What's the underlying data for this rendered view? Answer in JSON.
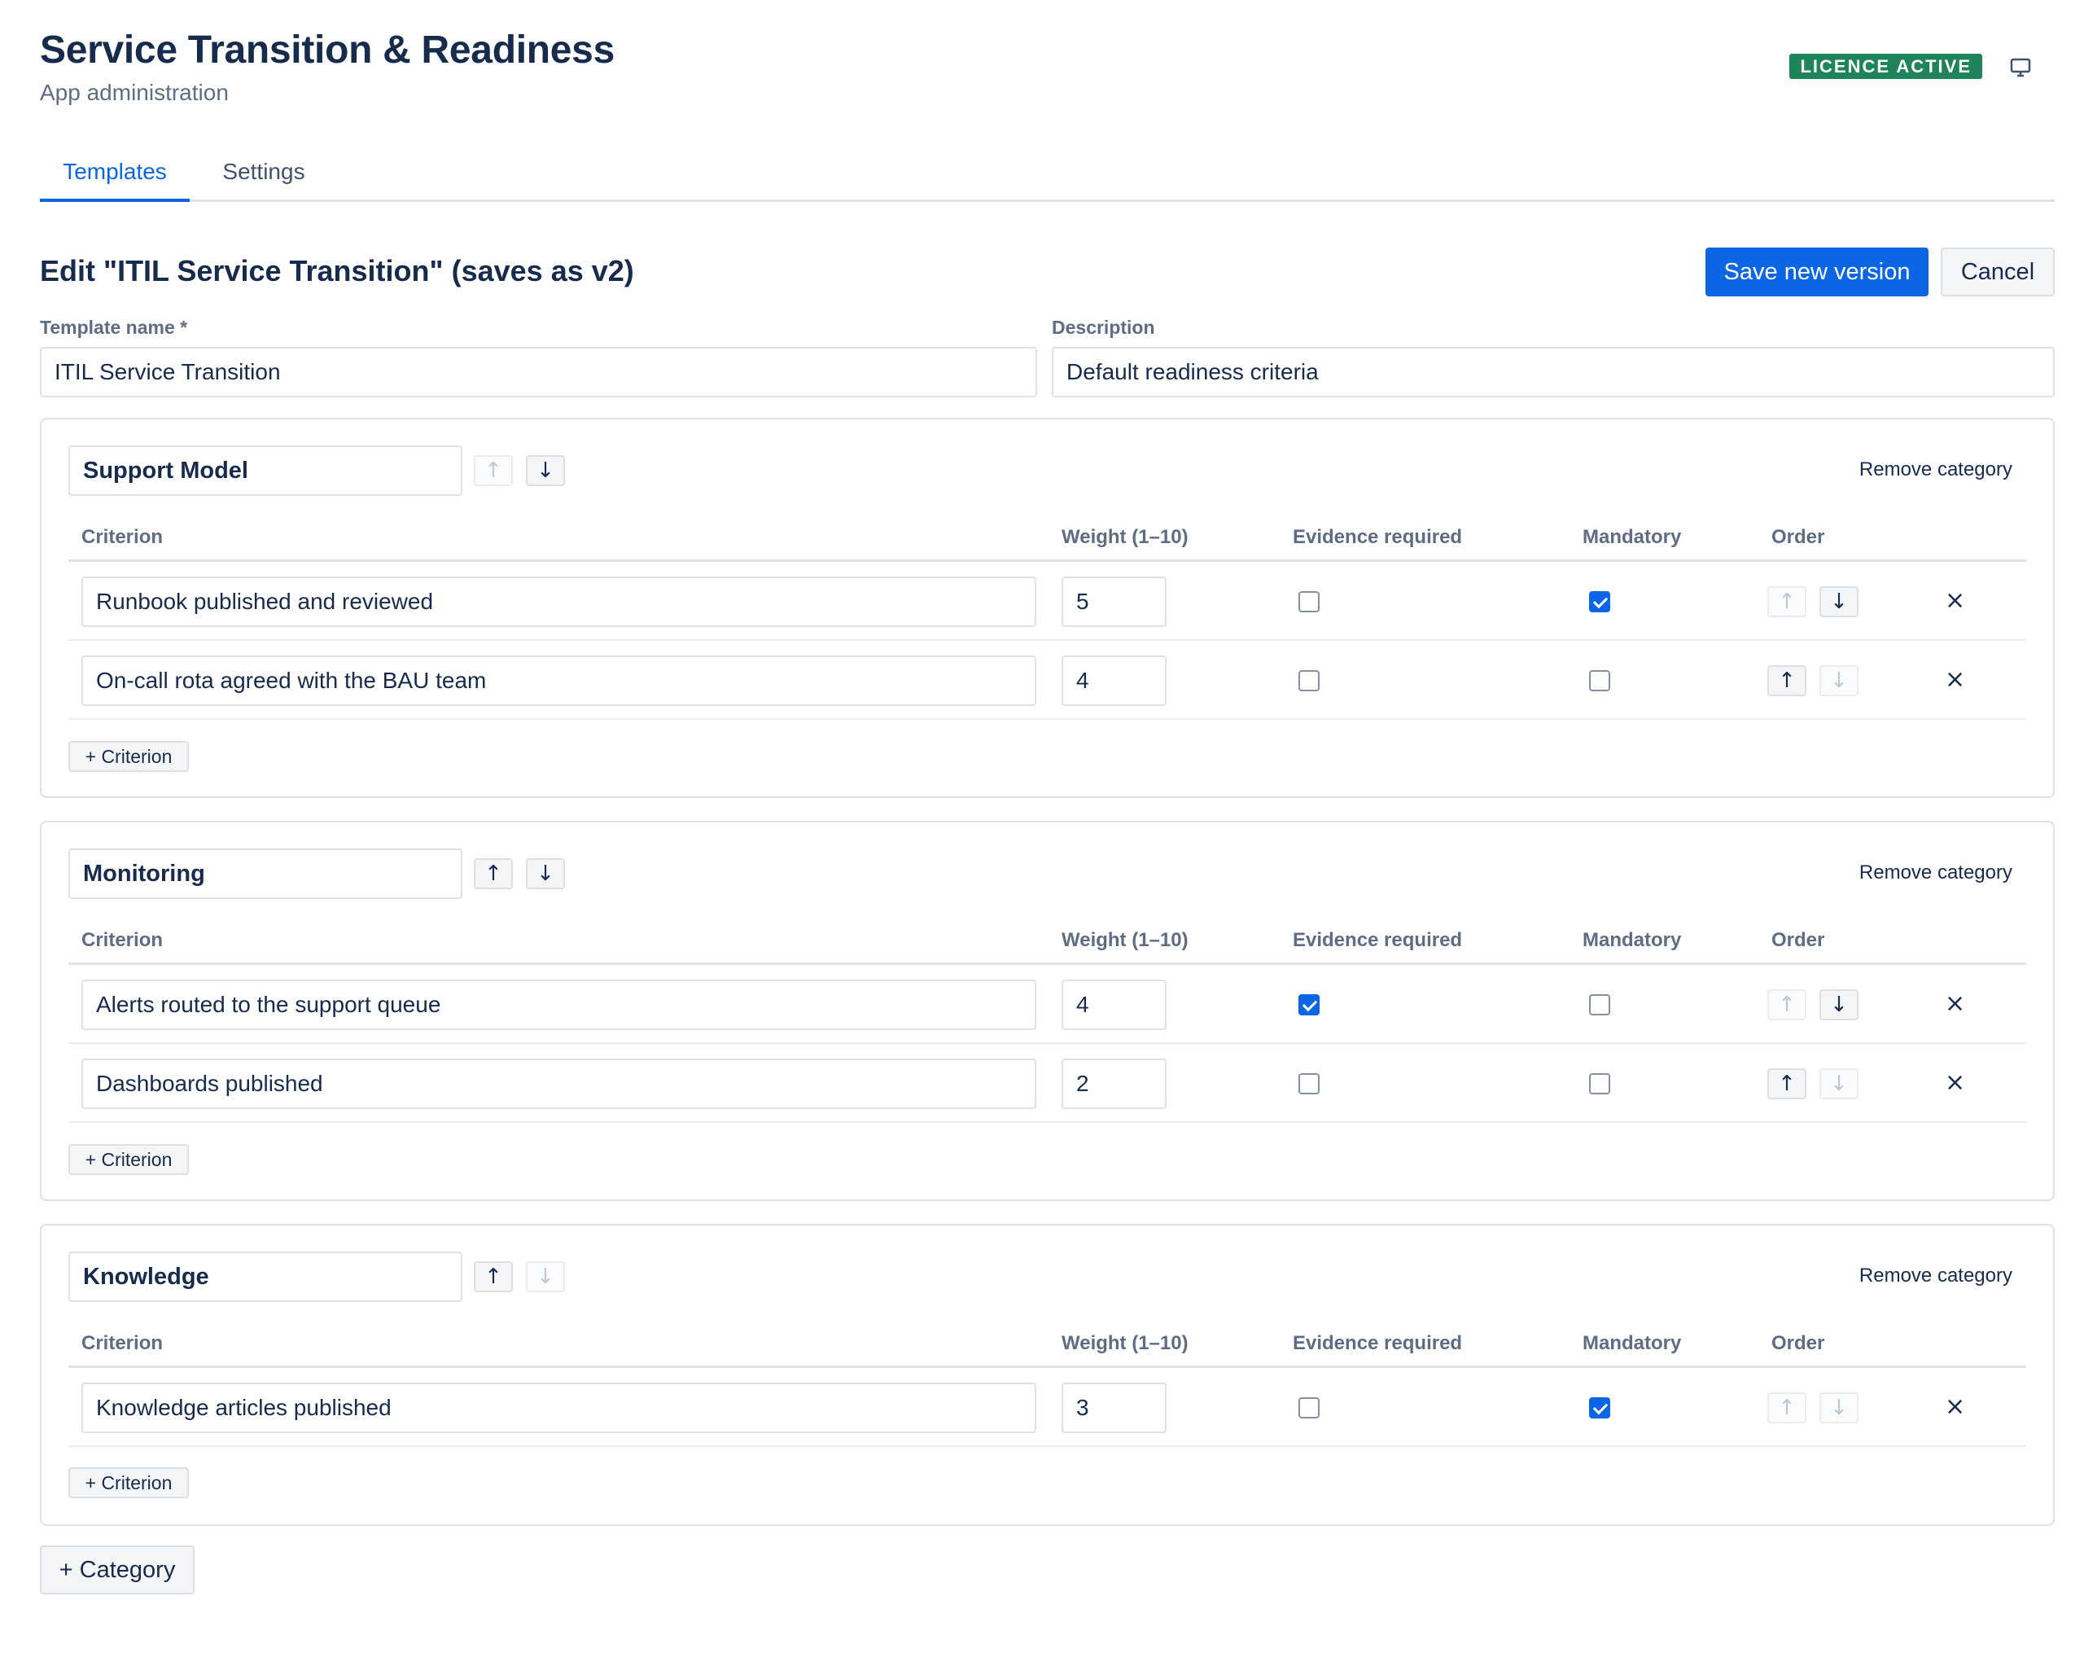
{
  "header": {
    "title": "Service Transition & Readiness",
    "subtitle": "App administration",
    "licence_badge": "LICENCE ACTIVE",
    "icon": "monitor-icon"
  },
  "tabs": [
    {
      "label": "Templates",
      "active": true
    },
    {
      "label": "Settings",
      "active": false
    }
  ],
  "edit": {
    "title": "Edit \"ITIL Service Transition\" (saves as v2)",
    "save_label": "Save new version",
    "cancel_label": "Cancel",
    "name_label": "Template name *",
    "name_value": "ITIL Service Transition",
    "description_label": "Description",
    "description_value": "Default readiness criteria"
  },
  "columns": {
    "criterion": "Criterion",
    "weight": "Weight (1–10)",
    "evidence": "Evidence required",
    "mandatory": "Mandatory",
    "order": "Order"
  },
  "labels": {
    "remove_category": "Remove category",
    "add_criterion": "+ Criterion",
    "add_category": "+ Category",
    "up_arrow": "↑",
    "down_arrow": "↓",
    "delete": "×"
  },
  "categories": [
    {
      "name": "Support Model",
      "criteria": [
        {
          "text": "Runbook published and reviewed",
          "weight": "5",
          "evidence": false,
          "mandatory": true
        },
        {
          "text": "On-call rota agreed with the BAU team",
          "weight": "4",
          "evidence": false,
          "mandatory": false
        }
      ]
    },
    {
      "name": "Monitoring",
      "criteria": [
        {
          "text": "Alerts routed to the support queue",
          "weight": "4",
          "evidence": true,
          "mandatory": false
        },
        {
          "text": "Dashboards published",
          "weight": "2",
          "evidence": false,
          "mandatory": false
        }
      ]
    },
    {
      "name": "Knowledge",
      "criteria": [
        {
          "text": "Knowledge articles published",
          "weight": "3",
          "evidence": false,
          "mandatory": true
        }
      ]
    }
  ]
}
